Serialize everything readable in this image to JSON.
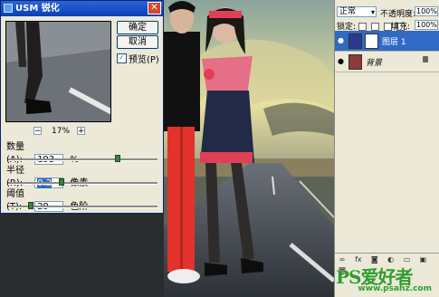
{
  "dialog": {
    "title": "USM 锐化",
    "close_glyph": "✕",
    "ok_label": "确定",
    "cancel_label": "取消",
    "preview_label": "预览(P)",
    "preview_checked": true,
    "zoom_minus": "−",
    "zoom_plus": "+",
    "zoom_level": "17%",
    "amount": {
      "label": "数量(A):",
      "value": "193",
      "unit": "%",
      "slider_fraction": 0.74
    },
    "radius": {
      "label": "半径(R):",
      "value": "0.2",
      "unit": "像素",
      "slider_fraction": 0.35
    },
    "threshold": {
      "label": "阈值(T):",
      "value": "29",
      "unit": "色阶",
      "slider_fraction": 0.14
    }
  },
  "layers_panel": {
    "blend_mode": "正常",
    "opacity_label": "不透明度:",
    "opacity_value": "100%",
    "lock_label": "锁定:",
    "fill_label": "填充:",
    "fill_value": "100%",
    "layers": [
      {
        "name": "图层 1",
        "active": true,
        "visible": true,
        "has_mask": true
      },
      {
        "name": "背景",
        "active": false,
        "visible": true,
        "locked": true
      }
    ],
    "footer_icons": [
      "link-icon",
      "fx-icon",
      "mask-icon",
      "adjustment-icon",
      "folder-icon",
      "new-layer-icon",
      "trash-icon"
    ],
    "footer_glyphs": [
      "∞",
      "fx",
      "◙",
      "◐",
      "▭",
      "▣",
      "🗑"
    ]
  },
  "watermark": {
    "brand": "PS爱好者",
    "url": "www.psahz.com",
    "color": "#2e9d2e"
  },
  "colors": {
    "titlebar": "#0a3fb5",
    "active_layer": "#316ac5",
    "dress_red": "#e23e58"
  }
}
